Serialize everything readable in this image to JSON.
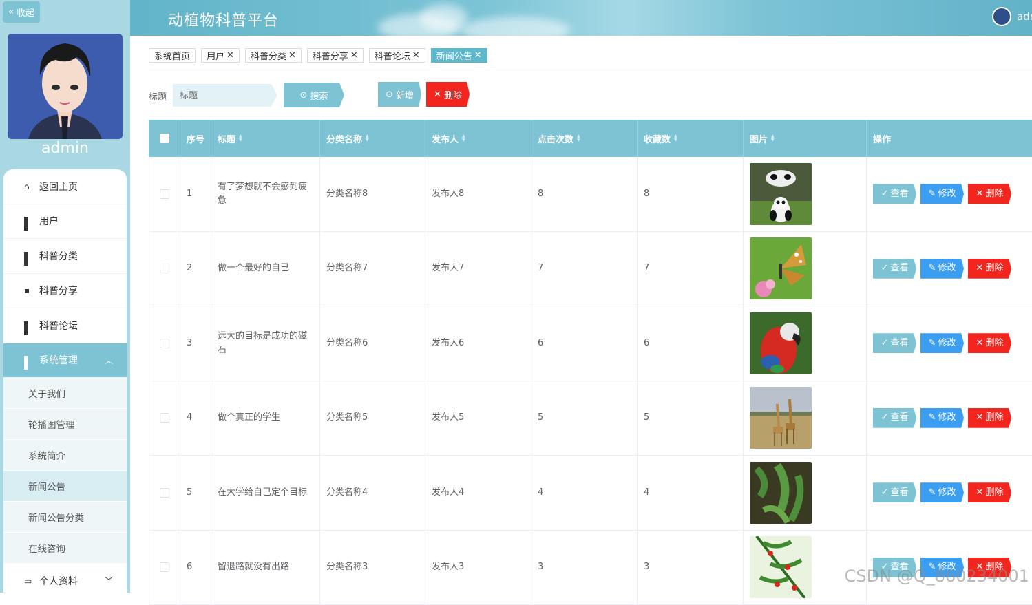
{
  "sidebar": {
    "collapse_label": "收起",
    "username": "admin",
    "menu": [
      {
        "label": "返回主页",
        "icon": "home-icon"
      },
      {
        "label": "用户",
        "icon": "grid-icon"
      },
      {
        "label": "科普分类",
        "icon": "grid-icon"
      },
      {
        "label": "科普分享",
        "icon": "chat-icon"
      },
      {
        "label": "科普论坛",
        "icon": "grid-icon"
      },
      {
        "label": "系统管理",
        "icon": "grid-icon"
      }
    ],
    "submenu": [
      "关于我们",
      "轮播图管理",
      "系统简介",
      "新闻公告",
      "新闻公告分类",
      "在线咨询"
    ],
    "profile_label": "个人资料"
  },
  "header": {
    "title": "动植物科普平台",
    "user": "admin"
  },
  "tags": [
    "系统首页",
    "用户",
    "科普分类",
    "科普分享",
    "科普论坛",
    "新闻公告"
  ],
  "search": {
    "label": "标题",
    "placeholder": "标题",
    "search_btn": "搜索",
    "add_btn": "新增",
    "delete_btn": "删除"
  },
  "table": {
    "columns": [
      "序号",
      "标题",
      "分类名称",
      "发布人",
      "点击次数",
      "收藏数",
      "图片",
      "操作"
    ],
    "rows": [
      {
        "no": "1",
        "title": "有了梦想就不会感到疲惫",
        "category": "分类名称8",
        "author": "发布人8",
        "clicks": "8",
        "favorites": "8",
        "image": "panda-photo"
      },
      {
        "no": "2",
        "title": "做一个最好的自己",
        "category": "分类名称7",
        "author": "发布人7",
        "clicks": "7",
        "favorites": "7",
        "image": "butterfly-photo"
      },
      {
        "no": "3",
        "title": "远大的目标是成功的磁石",
        "category": "分类名称6",
        "author": "发布人6",
        "clicks": "6",
        "favorites": "6",
        "image": "parrot-photo"
      },
      {
        "no": "4",
        "title": "做个真正的学生",
        "category": "分类名称5",
        "author": "发布人5",
        "clicks": "5",
        "favorites": "5",
        "image": "giraffe-photo"
      },
      {
        "no": "5",
        "title": "在大学给自己定个目标",
        "category": "分类名称4",
        "author": "发布人4",
        "clicks": "4",
        "favorites": "4",
        "image": "plant-photo"
      },
      {
        "no": "6",
        "title": "留退路就没有出路",
        "category": "分类名称3",
        "author": "发布人3",
        "clicks": "3",
        "favorites": "3",
        "image": "berry-plant-photo"
      }
    ],
    "actions": {
      "view": "查看",
      "edit": "修改",
      "delete": "删除"
    }
  },
  "watermark": "CSDN @Q_860234001"
}
